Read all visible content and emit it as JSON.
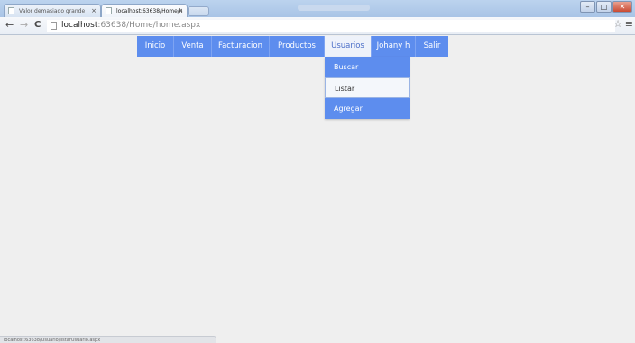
{
  "browser": {
    "tabs": [
      {
        "title": "Valor demasiado grande",
        "close": "×"
      },
      {
        "title": "localhost:63638/Home/h",
        "close": "×"
      }
    ],
    "window_buttons": {
      "minimize": "–",
      "maximize": "□",
      "close": "✕"
    },
    "nav": {
      "back": "←",
      "forward": "→",
      "reload": "C"
    },
    "url_host": "localhost",
    "url_rest": ":63638/Home/home.aspx",
    "star": "☆",
    "menu": "≡"
  },
  "menu": {
    "items": [
      {
        "label": "Inicio"
      },
      {
        "label": "Venta"
      },
      {
        "label": "Facturacion"
      },
      {
        "label": "Productos"
      },
      {
        "label": "Usuarios"
      },
      {
        "label": "Johany h"
      },
      {
        "label": "Salir"
      }
    ],
    "active": "Usuarios"
  },
  "dropdown": {
    "items": [
      {
        "label": "Buscar"
      },
      {
        "label": "Listar"
      },
      {
        "label": "Agregar"
      }
    ],
    "hovered": "Listar"
  },
  "status": {
    "text": "localhost:63638/Usuario/listarUsuario.aspx"
  },
  "colors": {
    "menu_bg": "#5d8dee",
    "menu_active_bg": "#eef2fa",
    "page_bg": "#efefef"
  }
}
